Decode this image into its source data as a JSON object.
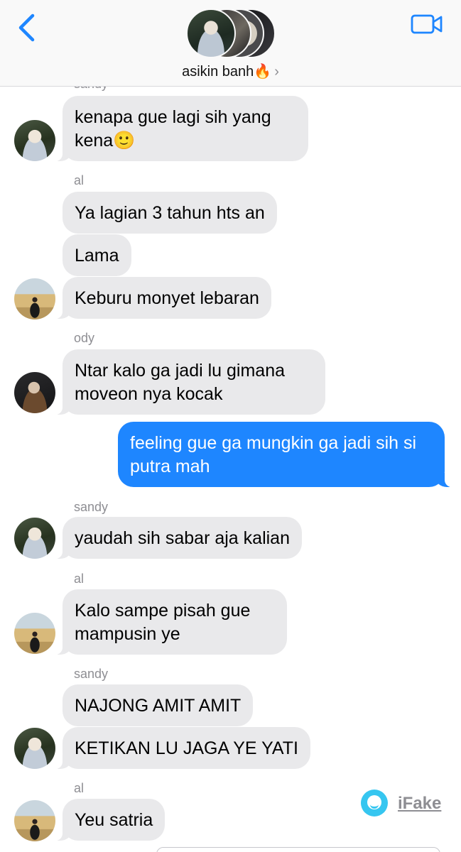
{
  "header": {
    "group_name": "asikin banh🔥",
    "chevron": "›",
    "back_icon": "chevron-left-icon",
    "video_icon": "video-camera-icon",
    "accent_color": "#1e86ff"
  },
  "messages": [
    {
      "sender": "sandy",
      "text": "kenapa gue lagi sih yang kena🙂"
    },
    {
      "sender": "al",
      "text": "Ya lagian 3 tahun hts an"
    },
    {
      "text": "Lama"
    },
    {
      "text": "Keburu monyet lebaran"
    },
    {
      "sender": "ody",
      "text": "Ntar kalo ga jadi lu gimana moveon nya kocak"
    },
    {
      "outgoing": true,
      "text": "feeling gue ga mungkin ga jadi sih si putra mah"
    },
    {
      "sender": "sandy",
      "text": "yaudah sih sabar aja kalian"
    },
    {
      "sender": "al",
      "text": "Kalo sampe pisah gue mampusin ye"
    },
    {
      "sender": "sandy",
      "text": "NAJONG AMIT AMIT"
    },
    {
      "text": "KETIKAN LU JAGA YE YATI"
    },
    {
      "sender": "al",
      "text": "Yeu satria"
    }
  ],
  "watermark": {
    "text": "iFake",
    "icon": "smiley-logo-icon"
  }
}
